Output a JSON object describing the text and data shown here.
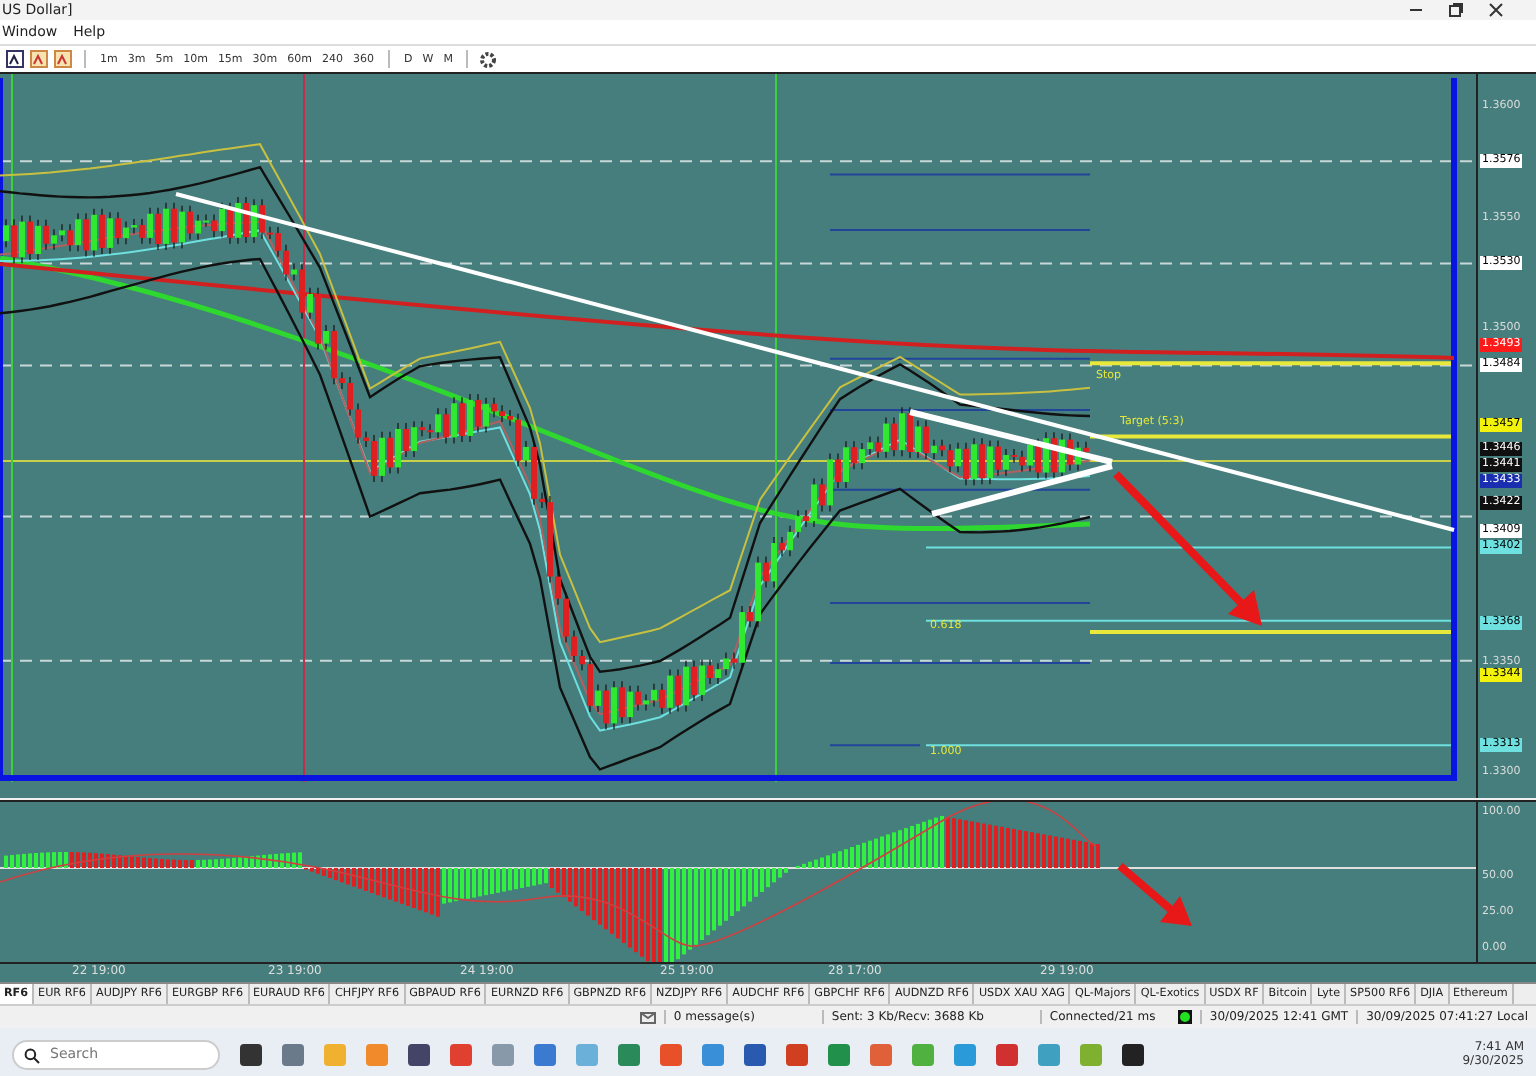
{
  "window": {
    "title": "US Dollar]"
  },
  "menu": [
    "Window",
    "Help"
  ],
  "toolbar": {
    "timeframes": [
      "1m",
      "3m",
      "5m",
      "10m",
      "15m",
      "30m",
      "60m",
      "240",
      "360"
    ],
    "periods": [
      "D",
      "W",
      "M"
    ]
  },
  "price_axis": {
    "ticks": [
      "1.3600",
      "1.3550",
      "1.3500",
      "1.3350",
      "1.3300"
    ],
    "labels": [
      {
        "text": "1.3576",
        "color": "#ffffff"
      },
      {
        "text": "1.3530",
        "color": "#ffffff"
      },
      {
        "text": "1.3493",
        "color": "#ff1a1a"
      },
      {
        "text": "1.3484",
        "color": "#ffffff"
      },
      {
        "text": "1.3457",
        "color": "#f2f20a"
      },
      {
        "text": "1.3446",
        "color": "#101010"
      },
      {
        "text": "1.3441",
        "color": "#101010"
      },
      {
        "text": "1.3433",
        "color": "#1a2fb0"
      },
      {
        "text": "1.3422",
        "color": "#101010"
      },
      {
        "text": "1.3409",
        "color": "#ffffff"
      },
      {
        "text": "1.3402",
        "color": "#6fe0e0"
      },
      {
        "text": "1.3368",
        "color": "#6fe0e0"
      },
      {
        "text": "1.3344",
        "color": "#f2f20a"
      },
      {
        "text": "1.3313",
        "color": "#6fe0e0"
      }
    ]
  },
  "chart_labels": [
    "Stop",
    "Target (5:3)",
    "0.618",
    "1.000"
  ],
  "oscillator_axis": [
    "100.00",
    "50.00",
    "25.00",
    "0.00"
  ],
  "time_axis": [
    "22 19:00",
    "23 19:00",
    "24 19:00",
    "25 19:00",
    "28 17:00",
    "29 19:00"
  ],
  "symbol_tabs": [
    {
      "label": "RF6",
      "selected": true
    },
    {
      "label": "EUR RF6",
      "selected": false
    },
    {
      "label": "AUDJPY RF6",
      "selected": false
    },
    {
      "label": "EURGBP RF6",
      "selected": false
    },
    {
      "label": "EURAUD RF6",
      "selected": false
    },
    {
      "label": "CHFJPY RF6",
      "selected": false
    },
    {
      "label": "GBPAUD RF6",
      "selected": false
    },
    {
      "label": "EURNZD RF6",
      "selected": false
    },
    {
      "label": "GBPNZD RF6",
      "selected": false
    },
    {
      "label": "NZDJPY RF6",
      "selected": false
    },
    {
      "label": "AUDCHF RF6",
      "selected": false
    },
    {
      "label": "GBPCHF RF6",
      "selected": false
    },
    {
      "label": "AUDNZD RF6",
      "selected": false
    },
    {
      "label": "USDX XAU XAG",
      "selected": false
    },
    {
      "label": "QL-Majors",
      "selected": false
    },
    {
      "label": "QL-Exotics",
      "selected": false
    },
    {
      "label": "USDX RF",
      "selected": false
    },
    {
      "label": "Bitcoin",
      "selected": false
    },
    {
      "label": "Lyte",
      "selected": false
    },
    {
      "label": "SP500 RF6",
      "selected": false
    },
    {
      "label": "DJIA",
      "selected": false
    },
    {
      "label": "Ethereum",
      "selected": false
    }
  ],
  "status_bar": {
    "messages": "0 message(s)",
    "traffic": "Sent: 3 Kb/Recv: 3688 Kb",
    "connection": "Connected/21 ms",
    "gmt_time": "30/09/2025 12:41 GMT",
    "local_time": "30/09/2025 07:41:27 Local"
  },
  "taskbar": {
    "search": {
      "placeholder": "Search"
    },
    "time": "7:41 AM",
    "date": "9/30/2025"
  }
}
